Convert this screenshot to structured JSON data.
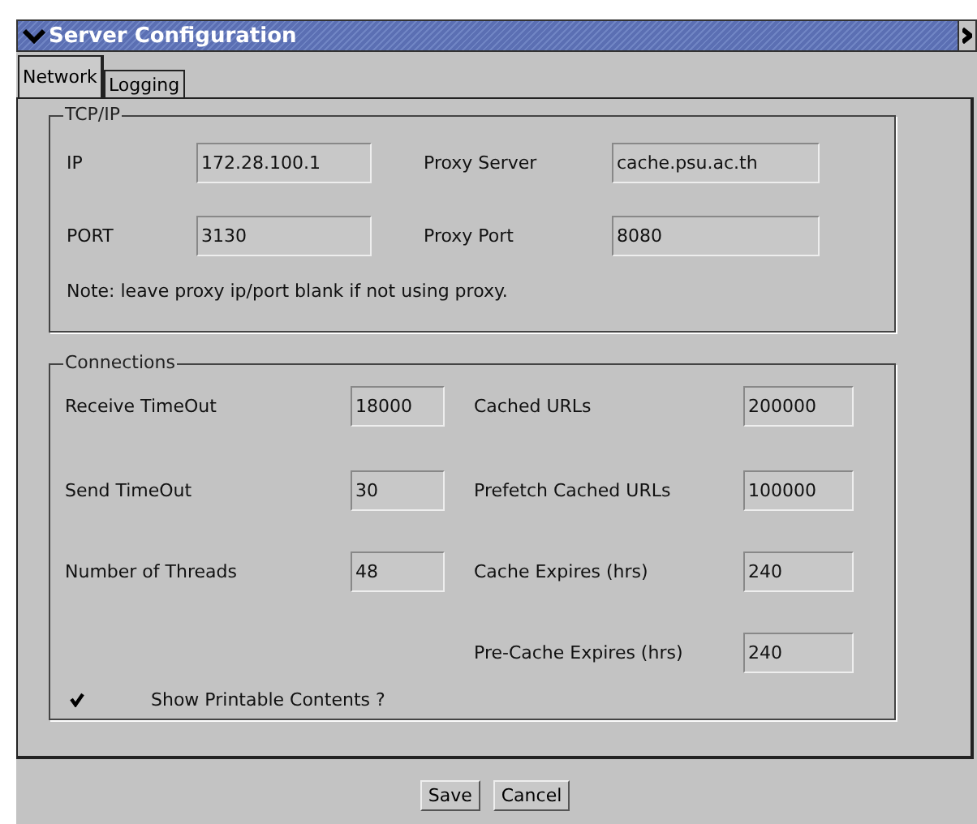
{
  "window": {
    "title": "Server Configuration"
  },
  "tabs": [
    {
      "label": "Network",
      "selected": true
    },
    {
      "label": "Logging",
      "selected": false
    }
  ],
  "tcp_ip": {
    "title": "TCP/IP",
    "fields": [
      {
        "label": "IP",
        "value": "172.28.100.1"
      },
      {
        "label": "Proxy Server",
        "value": "cache.psu.ac.th"
      },
      {
        "label": "PORT",
        "value": "3130"
      },
      {
        "label": "Proxy Port",
        "value": "8080"
      }
    ],
    "note": "Note: leave proxy ip/port blank if not using proxy."
  },
  "connections": {
    "title": "Connections",
    "left": [
      {
        "label": "Receive TimeOut",
        "value": "18000"
      },
      {
        "label": "Send TimeOut",
        "value": "30"
      },
      {
        "label": "Number of Threads",
        "value": "48"
      }
    ],
    "right": [
      {
        "label": "Cached URLs",
        "value": "200000"
      },
      {
        "label": "Prefetch Cached URLs",
        "value": "100000"
      },
      {
        "label": "Cache Expires (hrs)",
        "value": "240"
      },
      {
        "label": "Pre-Cache Expires (hrs)",
        "value": "240"
      }
    ],
    "checkbox": {
      "label": "Show Printable Contents ?",
      "checked": true
    }
  },
  "buttons": [
    "Save",
    "Cancel"
  ]
}
